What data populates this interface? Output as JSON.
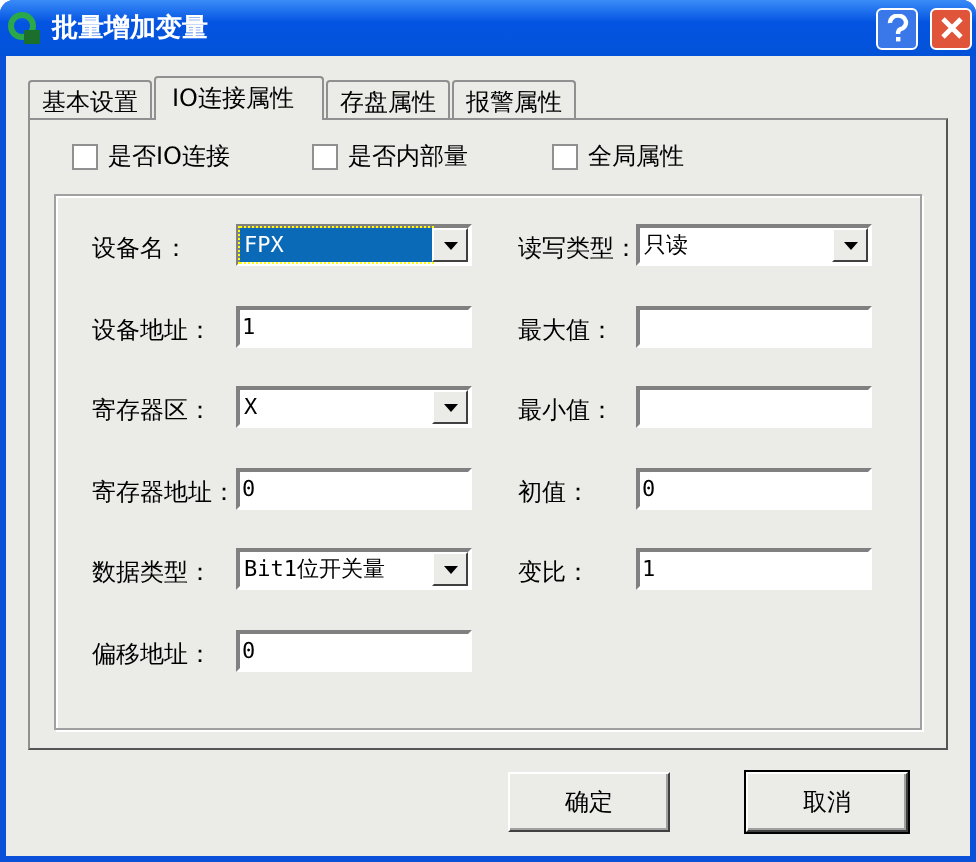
{
  "window": {
    "title": "批量增加变量"
  },
  "tabs": [
    {
      "label": "基本设置",
      "selected": false
    },
    {
      "label": "IO连接属性",
      "selected": true
    },
    {
      "label": "存盘属性",
      "selected": false
    },
    {
      "label": "报警属性",
      "selected": false
    }
  ],
  "checkboxes": [
    {
      "label": "是否IO连接",
      "checked": false
    },
    {
      "label": "是否内部量",
      "checked": false
    },
    {
      "label": "全局属性",
      "checked": false
    }
  ],
  "fields_left": [
    {
      "label": "设备名：",
      "kind": "combo",
      "value": "FPX",
      "focused": true
    },
    {
      "label": "设备地址：",
      "kind": "text",
      "value": "1"
    },
    {
      "label": "寄存器区：",
      "kind": "combo",
      "value": "X",
      "focused": false
    },
    {
      "label": "寄存器地址：",
      "kind": "text",
      "value": "0"
    },
    {
      "label": "数据类型：",
      "kind": "combo",
      "value": "Bit1位开关量",
      "focused": false
    },
    {
      "label": "偏移地址：",
      "kind": "text",
      "value": "0"
    }
  ],
  "fields_right": [
    {
      "label": "读写类型：",
      "kind": "combo",
      "value": "只读",
      "focused": false
    },
    {
      "label": "最大值：",
      "kind": "text"
    },
    {
      "label": "最小值：",
      "kind": "text"
    },
    {
      "label": "初值：",
      "kind": "text",
      "value": "0"
    },
    {
      "label": "变比：",
      "kind": "text",
      "value": "1"
    }
  ],
  "buttons": [
    "确定",
    "取消"
  ]
}
